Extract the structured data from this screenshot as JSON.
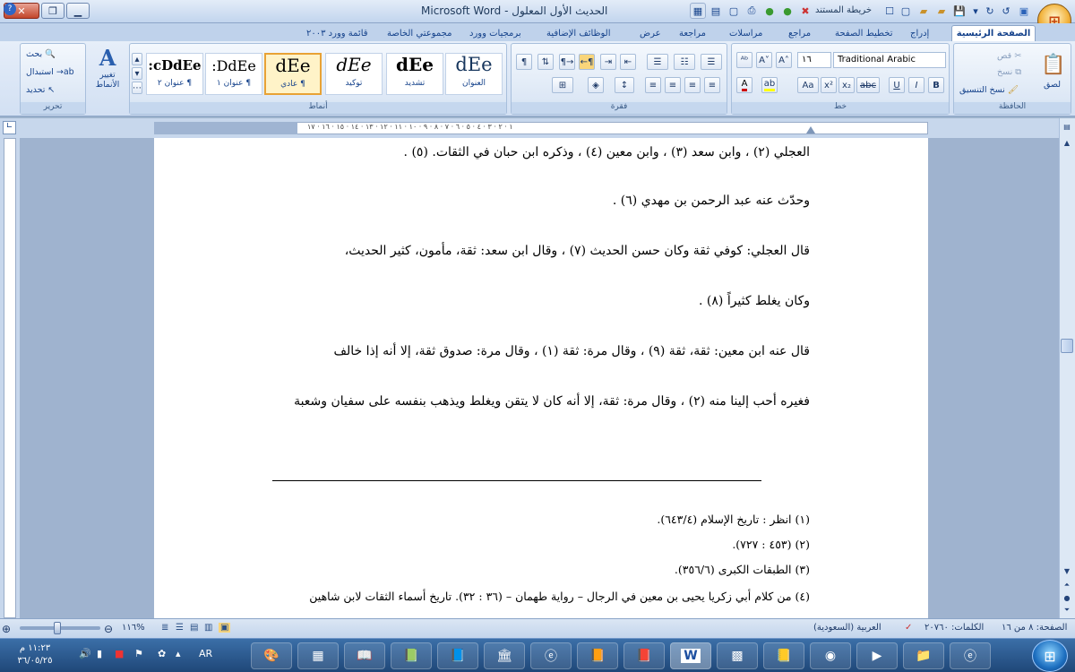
{
  "window": {
    "title": "الحديث الأول المعلول - Microsoft Word",
    "quick_access_label": "خريطة المستند"
  },
  "tabs": [
    {
      "label": "الصفحة الرئيسية"
    },
    {
      "label": "إدراج"
    },
    {
      "label": "تخطيط الصفحة"
    },
    {
      "label": "مراجع"
    },
    {
      "label": "مراسلات"
    },
    {
      "label": "مراجعة"
    },
    {
      "label": "عرض"
    },
    {
      "label": "الوظائف الإضافية"
    },
    {
      "label": "برمجيات وورد"
    },
    {
      "label": "مجموعتي الخاصة"
    },
    {
      "label": "قائمة وورد ٢٠٠٣"
    }
  ],
  "ribbon": {
    "clipboard": {
      "caption": "الحافظة",
      "paste": "لصق",
      "cut": "قص",
      "copy": "نسخ",
      "format_painter": "نسخ التنسيق"
    },
    "font": {
      "caption": "خط",
      "name": "Traditional Arabic",
      "size": "١٦"
    },
    "paragraph": {
      "caption": "فقرة"
    },
    "styles": {
      "caption": "أنماط",
      "change_styles": "تغيير الأنماط",
      "items": [
        {
          "sample": "dEe",
          "label": "العنوان"
        },
        {
          "sample": "dEe",
          "label": "تشديد"
        },
        {
          "sample": "dEe",
          "label": "توكيد"
        },
        {
          "sample": "dEe",
          "label": "¶ عادي"
        },
        {
          "sample": ":DdEe",
          "label": "¶ عنوان ١"
        },
        {
          "sample": ":cDdEe",
          "label": "¶ عنوان ٢"
        }
      ]
    },
    "editing": {
      "caption": "تحرير",
      "find": "بحث",
      "replace": "استبدال",
      "select": "تحديد"
    }
  },
  "ruler": {
    "ticks": "١ · ٢ · ٣ · ٤ · ٥ · ٦ · ٧ · ٨ · ٩ · ١٠ · ١١ · ١٢ · ١٣ · ١٤ · ١٥ · ١٦ · ١٧"
  },
  "document": {
    "lines": [
      "العجلي (٢) ، وابن سعد (٣) ، وابن معين (٤) ، وذكره ابن حبان في الثقات. (٥) .",
      "وحدّث عنه عبد الرحمن بن مهدي (٦) .",
      "قال العجلي: كوفي ثقة وكان حسن الحديث (٧) ، وقال ابن سعد: ثقة، مأمون، كثير الحديث،",
      "وكان يغلط كثيراً (٨) .",
      "قال عنه ابن معين: ثقة، ثقة (٩) ، وقال مرة: ثقة (١) ، وقال مرة: صدوق ثقة، إلا أنه إذا خالف",
      "فغيره أحب إلينا منه (٢) ، وقال مرة: ثقة، إلا أنه كان لا يتقن ويغلط ويذهب بنفسه على سفيان وشعبة"
    ],
    "footnotes": [
      "(١) انظر : تاريخ الإسلام (٦٤٣/٤).",
      "(٢) (٤٥٣ : ٧٢٧).",
      "(٣) الطبقات الكبرى (٣٥٦/٦).",
      "(٤) من كلام أبي زكريا يحيى بن معين في الرجال – رواية طهمان – (٣٦ : ٣٢). تاريخ أسماء الثقات لابن شاهين"
    ]
  },
  "statusbar": {
    "page": "الصفحة: ٨ من ١٦",
    "words": "الكلمات: ٢٠٧٦٠",
    "language": "العربية (السعودية)",
    "zoom": "%١١٦"
  },
  "taskbar": {
    "time": "١١:٢٣ م",
    "date": "٣٦/٠٥/٢٥",
    "lang": "AR"
  }
}
